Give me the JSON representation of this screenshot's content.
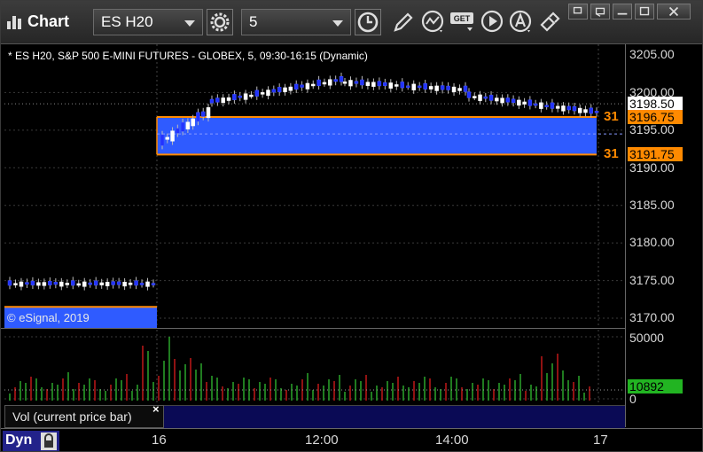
{
  "app": {
    "title": "Chart",
    "symbol": "ES H20",
    "interval": "5"
  },
  "chart": {
    "header": "* ES H20, S&P 500 E-MINI FUTURES - GLOBEX, 5, 09:30-16:15 (Dynamic)",
    "watermark": "© eSignal, 2019",
    "price_labels": [
      "3205.00",
      "3200.00",
      "3195.00",
      "3190.00",
      "3185.00",
      "3180.00",
      "3175.00",
      "3170.00"
    ],
    "last_price": "3198.50",
    "level_upper": "3196.75",
    "level_lower": "3191.75",
    "level_upper_cut": "31",
    "level_lower_cut": "31",
    "colors": {
      "zone": "#2f5bff",
      "level": "#ff8a00",
      "up": "#ffffff",
      "down": "#2233ff",
      "vol_up": "#2aa52a",
      "vol_down": "#c01818"
    }
  },
  "volume": {
    "label": "Vol (current price bar)",
    "close_glyph": "×",
    "axis_top": "50000",
    "axis_bottom": "0",
    "current": "10892"
  },
  "time_axis": {
    "ticks": [
      "16",
      "12:00",
      "14:00",
      "17"
    ]
  },
  "footer": {
    "mode_label": "Dyn"
  },
  "icons": [
    "app-chart-icon",
    "settings-gear-icon",
    "clock-icon",
    "pencil-draw-icon",
    "indicator-icon",
    "get-data-icon",
    "play-icon",
    "alert-icon",
    "link-icon",
    "restore-icon",
    "minimize-icon",
    "maximize-icon",
    "close-icon",
    "lock-icon"
  ]
}
